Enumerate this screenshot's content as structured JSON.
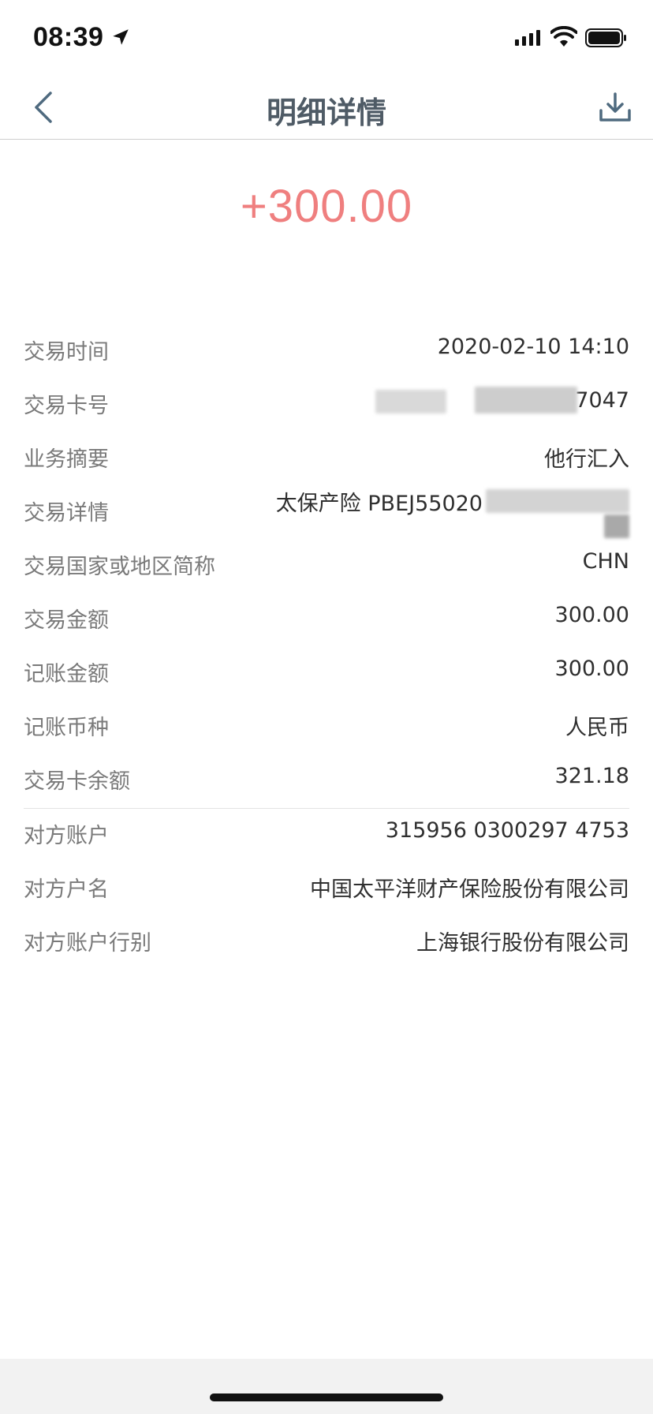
{
  "status_bar": {
    "time": "08:39",
    "icons": {
      "location": "location-arrow-icon",
      "signal": "signal-icon",
      "wifi": "wifi-icon",
      "battery": "battery-icon"
    }
  },
  "nav": {
    "title": "明细详情",
    "back_icon": "chevron-left-icon",
    "download_icon": "download-icon"
  },
  "amount": "+300.00",
  "colors": {
    "amount": "#ef7f7f",
    "nav_title": "#4f5b66",
    "icon_accent": "#4f6a7f",
    "label": "#7a7a7a",
    "value": "#2f2f2f"
  },
  "details": [
    {
      "label": "交易时间",
      "value": "2020-02-10 14:10"
    },
    {
      "label": "交易卡号",
      "value": "67047"
    },
    {
      "label": "业务摘要",
      "value": "他行汇入"
    },
    {
      "label": "交易详情",
      "value": "太保产险 PBEJ55020"
    },
    {
      "label": "交易国家或地区简称",
      "value": "CHN"
    },
    {
      "label": "交易金额",
      "value": "300.00"
    },
    {
      "label": "记账金额",
      "value": "300.00"
    },
    {
      "label": "记账币种",
      "value": "人民币"
    },
    {
      "label": "交易卡余额",
      "value": "321.18"
    }
  ],
  "counterparty": [
    {
      "label": "对方账户",
      "value": "315956 0300297 4753"
    },
    {
      "label": "对方户名",
      "value": "中国太平洋财产保险股份有限公司"
    },
    {
      "label": "对方账户行别",
      "value": "上海银行股份有限公司"
    }
  ]
}
